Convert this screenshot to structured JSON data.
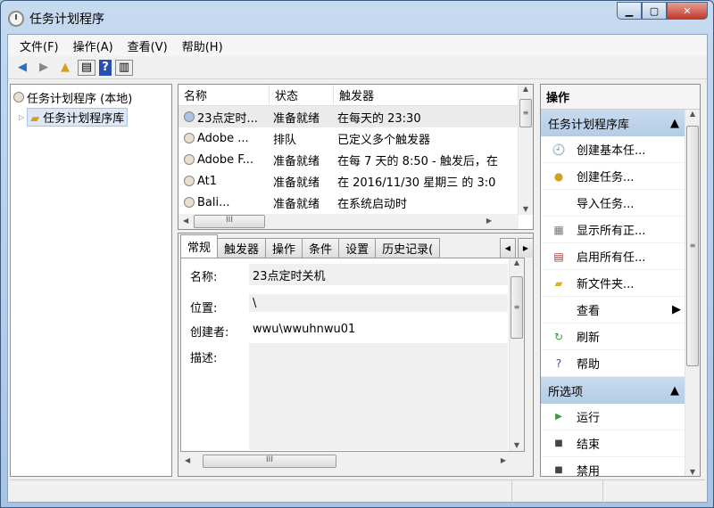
{
  "window": {
    "title": "任务计划程序"
  },
  "menu": [
    "文件(F)",
    "操作(A)",
    "查看(V)",
    "帮助(H)"
  ],
  "tree": {
    "root": "任务计划程序 (本地)",
    "child": "任务计划程序库"
  },
  "list": {
    "columns": [
      "名称",
      "状态",
      "触发器"
    ],
    "rows": [
      {
        "name": "23点定时...",
        "status": "准备就绪",
        "trigger": "在每天的 23:30"
      },
      {
        "name": "Adobe ...",
        "status": "排队",
        "trigger": "已定义多个触发器"
      },
      {
        "name": "Adobe F...",
        "status": "准备就绪",
        "trigger": "在每 7 天的 8:50 - 触发后，在"
      },
      {
        "name": "At1",
        "status": "准备就绪",
        "trigger": "在 2016/11/30 星期三 的 3:0"
      },
      {
        "name": "Bali...",
        "status": "准备就绪",
        "trigger": "在系统启动时"
      }
    ]
  },
  "tabs": [
    "常规",
    "触发器",
    "操作",
    "条件",
    "设置",
    "历史记录("
  ],
  "general": {
    "name_label": "名称:",
    "name": "23点定时关机",
    "location_label": "位置:",
    "location": "\\",
    "author_label": "创建者:",
    "author": "wwu\\wwuhnwu01",
    "desc_label": "描述:"
  },
  "actions": {
    "header": "操作",
    "section1": "任务计划程序库",
    "items1": [
      "创建基本任...",
      "创建任务...",
      "导入任务...",
      "显示所有正...",
      "启用所有任...",
      "新文件夹...",
      "查看",
      "刷新",
      "帮助"
    ],
    "section2": "所选项",
    "items2": [
      "运行",
      "结束",
      "禁用"
    ]
  }
}
